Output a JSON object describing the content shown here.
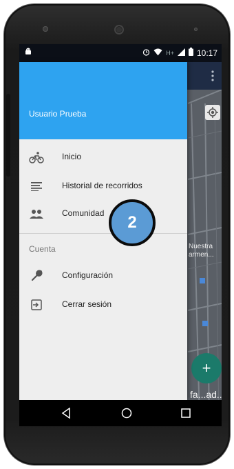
{
  "status_bar": {
    "time": "10:17",
    "network": "H+"
  },
  "drawer": {
    "user_name": "Usuario Prueba",
    "items": [
      {
        "label": "Inicio",
        "icon": "bike-icon"
      },
      {
        "label": "Historial de recorridos",
        "icon": "list-icon"
      },
      {
        "label": "Comunidad",
        "icon": "people-icon"
      }
    ],
    "section_title": "Cuenta",
    "account_items": [
      {
        "label": "Configuración",
        "icon": "wrench-icon"
      },
      {
        "label": "Cerrar sesión",
        "icon": "logout-icon"
      }
    ]
  },
  "map": {
    "label_1": "Nuestra\narmen...",
    "label_2": "fa...ad.."
  },
  "callout": {
    "number": "2",
    "color": "#5b9bd5"
  },
  "colors": {
    "drawer_header": "#2ea3f0",
    "app_bar": "#1f2c45",
    "fab": "#1b7a6a"
  }
}
